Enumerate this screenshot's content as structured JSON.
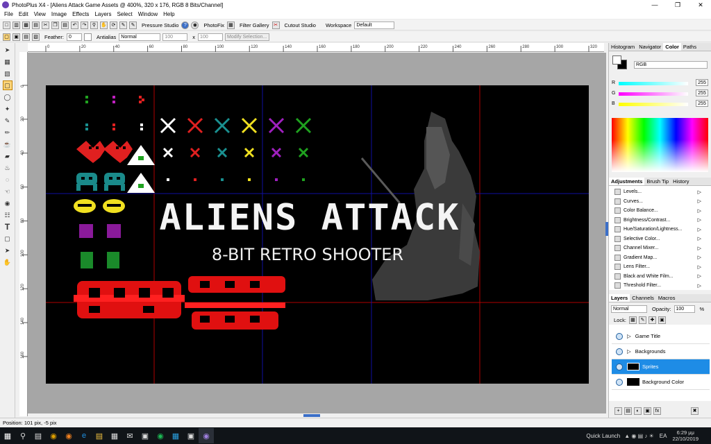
{
  "window": {
    "title": "PhotoPlus X4 - [Aliens Attack Game Assets @ 400%, 320 x 176, RGB 8 Bits/Channel]"
  },
  "menu": [
    "File",
    "Edit",
    "View",
    "Image",
    "Effects",
    "Layers",
    "Select",
    "Window",
    "Help"
  ],
  "toolbar1": {
    "pressure_studio": "Pressure Studio",
    "photofix": "PhotoFix",
    "filter_gallery": "Filter Gallery",
    "cutout_studio": "Cutout Studio",
    "workspace_label": "Workspace",
    "workspace_value": "Default"
  },
  "toolbar2": {
    "feather_label": "Feather:",
    "feather_value": "0",
    "antialias_label": "Antialias",
    "mode_value": "Normal",
    "width_value": "100",
    "x_label": "x",
    "height_value": "100",
    "modify_selection": "Modify Selection..."
  },
  "ruler": {
    "top": [
      "0",
      "20",
      "40",
      "60",
      "80",
      "100",
      "120",
      "140",
      "160",
      "180",
      "200",
      "220",
      "240",
      "260",
      "280",
      "300",
      "320"
    ],
    "left": [
      "0",
      "20",
      "40",
      "60",
      "80",
      "100",
      "120",
      "140",
      "160"
    ]
  },
  "canvas_art": {
    "title": "ALIENS ATTACK",
    "subtitle": "8-BIT RETRO SHOOTER"
  },
  "panels": {
    "color_tabs": [
      "Histogram",
      "Navigator",
      "Color",
      "Paths"
    ],
    "color_mode": "RGB",
    "channels": [
      {
        "label": "R",
        "value": "255"
      },
      {
        "label": "G",
        "value": "255"
      },
      {
        "label": "B",
        "value": "255"
      }
    ],
    "adjust_tabs": [
      "Adjustments",
      "Brush Tip",
      "History"
    ],
    "adjustments": [
      "Levels...",
      "Curves...",
      "Color Balance...",
      "Brightness/Contrast...",
      "Hue/Saturation/Lightness...",
      "Selective Color...",
      "Channel Mixer...",
      "Gradient Map...",
      "Lens Filter...",
      "Black and White Film...",
      "Threshold Filter..."
    ],
    "layer_tabs": [
      "Layers",
      "Channels",
      "Macros"
    ],
    "blend_mode": "Normal",
    "opacity_label": "Opacity:",
    "opacity_value": "100",
    "opacity_unit": "%",
    "lock_label": "Lock:",
    "layers": [
      "Game Title",
      "Backgrounds",
      "Sprites",
      "Background Color"
    ]
  },
  "status": {
    "position": "Position: 101 pix, -5 pix"
  },
  "taskbar": {
    "quick_launch": "Quick Launch",
    "lang": "EA",
    "time": "6:29 μμ",
    "date": "22/10/2019"
  }
}
